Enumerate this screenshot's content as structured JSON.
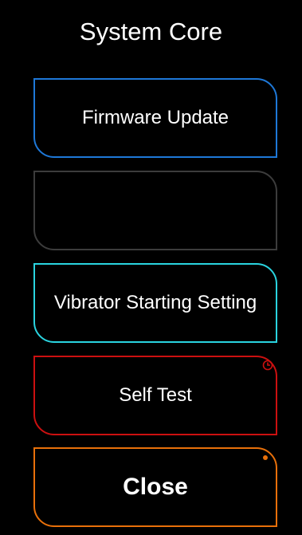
{
  "screen": {
    "title": "System Core"
  },
  "menu": {
    "firmware_label": "Firmware Update",
    "blank_label": "",
    "vibrator_label": "Vibrator Starting Setting",
    "self_test_label": "Self Test",
    "close_label": "Close"
  },
  "icons": {
    "self_test_indicator": "clock-icon",
    "close_indicator": "status-dot-icon"
  },
  "colors": {
    "background": "#000000",
    "text": "#ffffff",
    "firmware_border": "#1e78d8",
    "blank_border": "#3c3c3c",
    "vibrator_border": "#2ad4e0",
    "self_test_border": "#cc1010",
    "close_border": "#e8700a"
  }
}
